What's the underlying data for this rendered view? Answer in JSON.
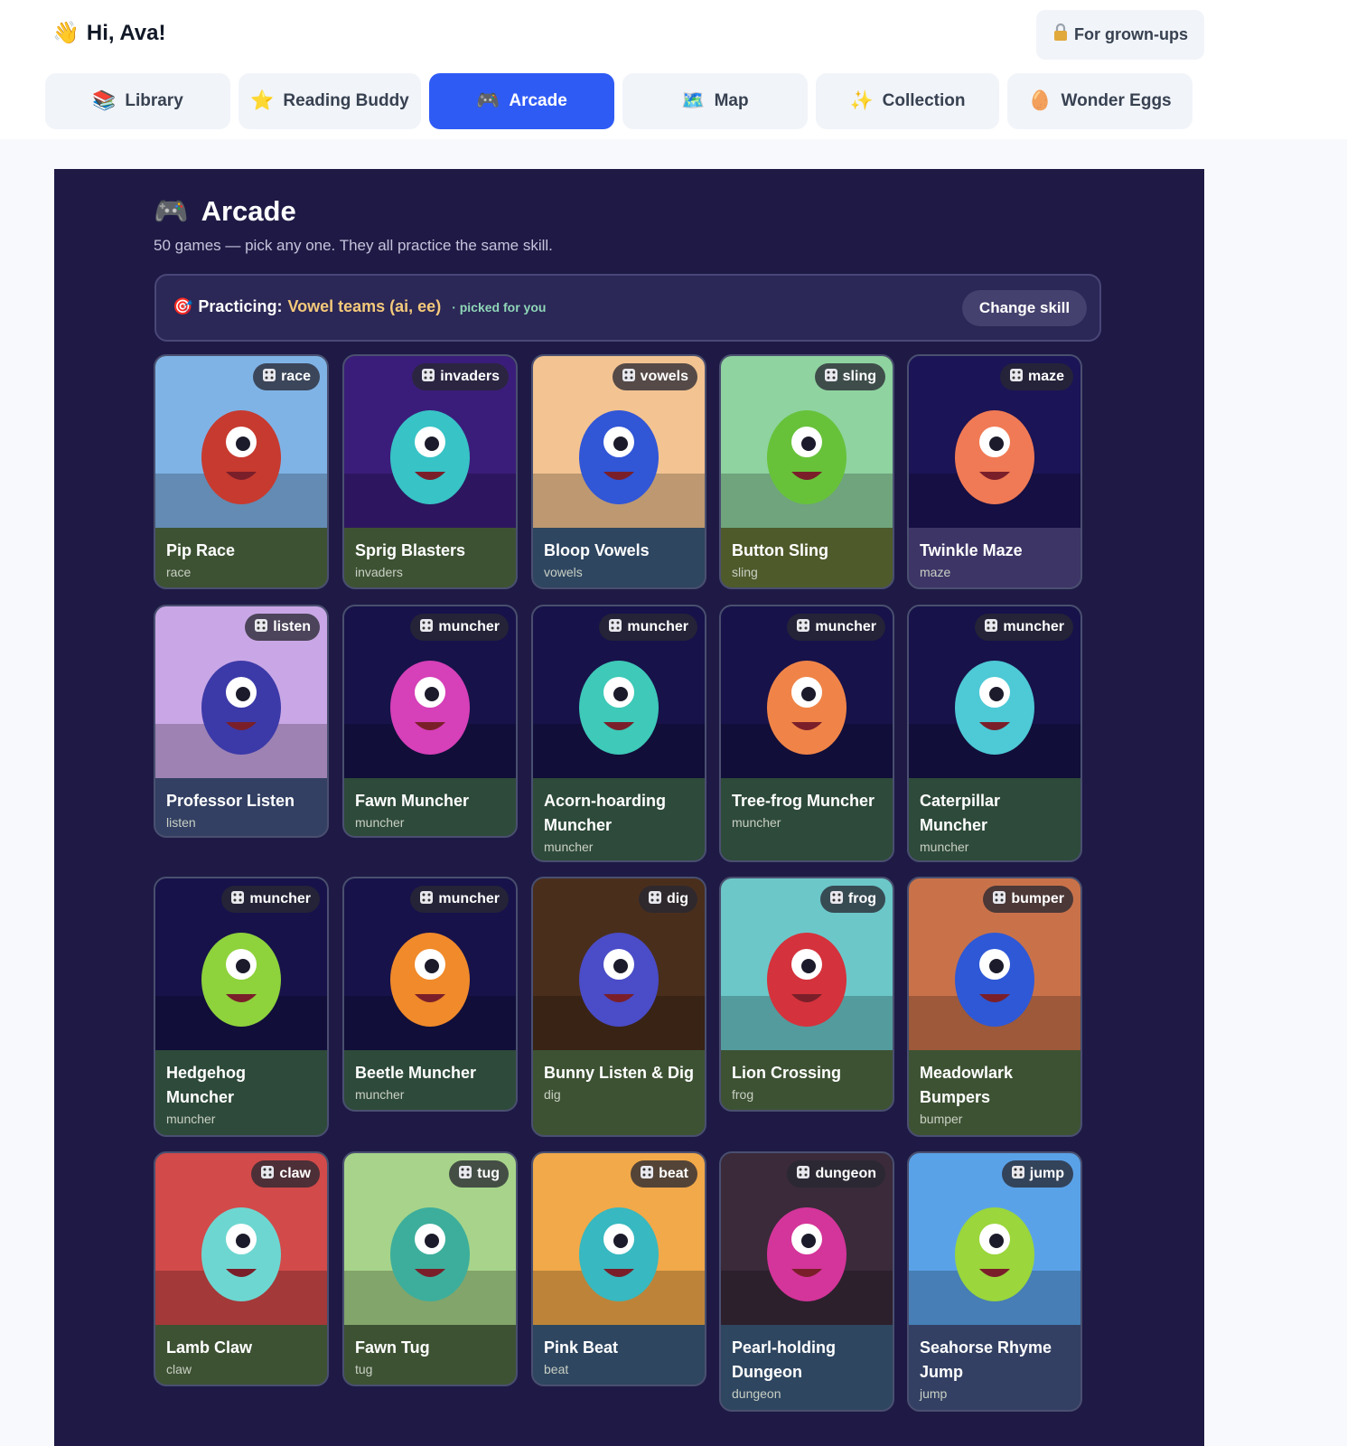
{
  "header": {
    "greeting_emoji": "👋",
    "greeting": "Hi, Ava!",
    "grownups_icon": "lock-icon",
    "grownups_label": "For grown-ups"
  },
  "tabs": [
    {
      "label": "Library",
      "icon": "📚",
      "active": false
    },
    {
      "label": "Reading Buddy",
      "icon": "⭐",
      "active": false
    },
    {
      "label": "Arcade",
      "icon": "🎮",
      "active": true
    },
    {
      "label": "Map",
      "icon": "🗺️",
      "active": false
    },
    {
      "label": "Collection",
      "icon": "✨",
      "active": false
    },
    {
      "label": "Wonder Eggs",
      "icon": "🥚",
      "active": false
    }
  ],
  "arcade": {
    "icon": "🎮",
    "title": "Arcade",
    "subtitle": "50 games — pick any one. They all practice the same skill.",
    "practice_icon": "🎯",
    "practice_label": "Practicing:",
    "practice_skill": "Vowel teams (ai, ee)",
    "practice_note": "· picked for you",
    "change_label": "Change skill"
  },
  "games": [
    {
      "name": "Pip Race",
      "type": "race",
      "badge": "race",
      "bg": "#3d5233",
      "art": "#c73a2f",
      "sky": "#7fb3e6"
    },
    {
      "name": "Sprig Blasters",
      "type": "invaders",
      "badge": "invaders",
      "bg": "#3d5233",
      "art": "#38c3c6",
      "sky": "#3a1d7a"
    },
    {
      "name": "Bloop Vowels",
      "type": "vowels",
      "badge": "vowels",
      "bg": "#2e4660",
      "art": "#3156d6",
      "sky": "#f3c391"
    },
    {
      "name": "Button Sling",
      "type": "sling",
      "badge": "sling",
      "bg": "#4f5a2b",
      "art": "#67c23a",
      "sky": "#8fd3a0"
    },
    {
      "name": "Twinkle Maze",
      "type": "maze",
      "badge": "maze",
      "bg": "#3d3566",
      "art": "#f07a55",
      "sky": "#1b1456"
    },
    {
      "name": "Professor Listen",
      "type": "listen",
      "badge": "listen",
      "bg": "#334063",
      "art": "#3c3aa8",
      "sky": "#c9a7e6"
    },
    {
      "name": "Fawn Muncher",
      "type": "muncher",
      "badge": "muncher",
      "bg": "#2e4a3a",
      "art": "#d640b8",
      "sky": "#17124a"
    },
    {
      "name": "Acorn-hoarding Muncher",
      "type": "muncher",
      "badge": "muncher",
      "bg": "#2e4a3a",
      "art": "#3ec9b8",
      "sky": "#17124a"
    },
    {
      "name": "Tree-frog Muncher",
      "type": "muncher",
      "badge": "muncher",
      "bg": "#2e4a3a",
      "art": "#f08448",
      "sky": "#17124a"
    },
    {
      "name": "Caterpillar Muncher",
      "type": "muncher",
      "badge": "muncher",
      "bg": "#2e4a3a",
      "art": "#4ec9d6",
      "sky": "#17124a"
    },
    {
      "name": "Hedgehog Muncher",
      "type": "muncher",
      "badge": "muncher",
      "bg": "#2e4a3a",
      "art": "#8ed23c",
      "sky": "#17124a"
    },
    {
      "name": "Beetle Muncher",
      "type": "muncher",
      "badge": "muncher",
      "bg": "#2e4a3a",
      "art": "#f08a2a",
      "sky": "#17124a"
    },
    {
      "name": "Bunny Listen & Dig",
      "type": "dig",
      "badge": "dig",
      "bg": "#3d5233",
      "art": "#4a4cc8",
      "sky": "#4a2e1c"
    },
    {
      "name": "Lion Crossing",
      "type": "frog",
      "badge": "frog",
      "bg": "#3d5233",
      "art": "#d4323c",
      "sky": "#6cc7c9"
    },
    {
      "name": "Meadowlark Bumpers",
      "type": "bumper",
      "badge": "bumper",
      "bg": "#3d5233",
      "art": "#2e58d6",
      "sky": "#c9724a"
    },
    {
      "name": "Lamb Claw",
      "type": "claw",
      "badge": "claw",
      "bg": "#3d5233",
      "art": "#6ed6d0",
      "sky": "#d24a4a"
    },
    {
      "name": "Fawn Tug",
      "type": "tug",
      "badge": "tug",
      "bg": "#3d5233",
      "art": "#3dae9c",
      "sky": "#a7d48a"
    },
    {
      "name": "Pink Beat",
      "type": "beat",
      "badge": "beat",
      "bg": "#2e4660",
      "art": "#38b8c0",
      "sky": "#f2a94a"
    },
    {
      "name": "Pearl-holding Dungeon",
      "type": "dungeon",
      "badge": "dungeon",
      "bg": "#2e4660",
      "art": "#d4359a",
      "sky": "#3a2a3a"
    },
    {
      "name": "Seahorse Rhyme Jump",
      "type": "jump",
      "badge": "jump",
      "bg": "#334063",
      "art": "#9ad63c",
      "sky": "#5aa2e8"
    }
  ]
}
